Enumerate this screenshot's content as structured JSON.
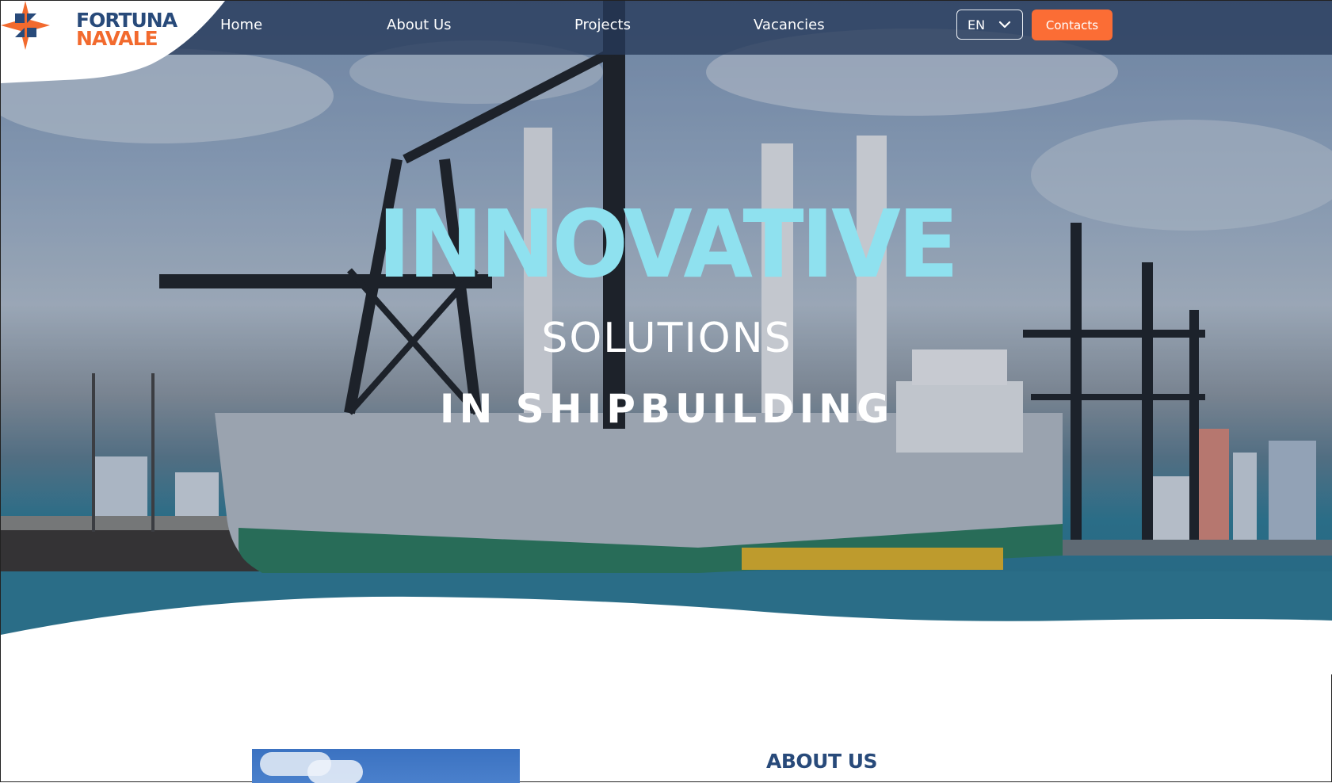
{
  "brand": {
    "name_line1": "FORTUNA",
    "name_line2": "NAVALE",
    "primary_color": "#284a7a",
    "accent_color": "#f26a2e"
  },
  "nav": {
    "items": [
      {
        "label": "Home"
      },
      {
        "label": "About Us"
      },
      {
        "label": "Projects"
      },
      {
        "label": "Vacancies"
      }
    ],
    "language": {
      "selected": "EN",
      "icon": "chevron-down-icon"
    },
    "contacts_label": "Contacts",
    "contacts_color": "#fb6d35"
  },
  "hero": {
    "line1": "INNOVATIVE",
    "line2": "SOLUTIONS",
    "line3": "IN SHIPBUILDING",
    "line1_color": "#8fe1ef"
  },
  "about": {
    "title": "ABOUT US"
  }
}
